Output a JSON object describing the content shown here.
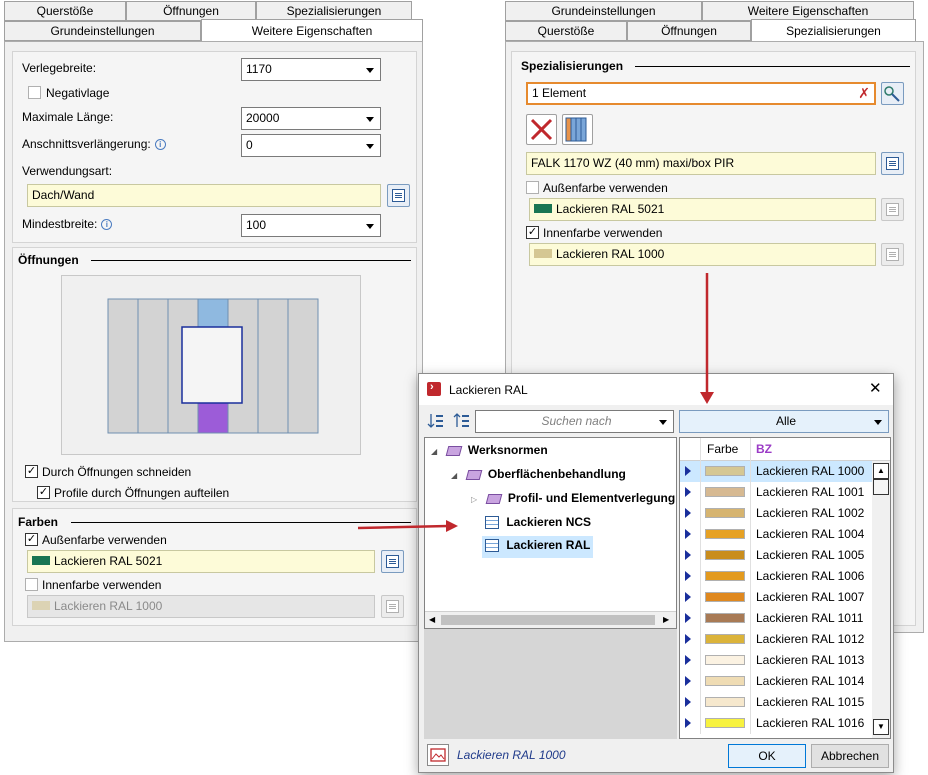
{
  "left": {
    "tabs_row1": [
      "Querstöße",
      "Öffnungen",
      "Spezialisierungen"
    ],
    "tabs_row2": [
      "Grundeinstellungen",
      "Weitere Eigenschaften"
    ],
    "verlegebreite_label": "Verlegebreite:",
    "verlegebreite_value": "1170",
    "negativlage_label": "Negativlage",
    "max_laenge_label": "Maximale Länge:",
    "max_laenge_value": "20000",
    "anschnitt_label": "Anschnittsverlängerung:",
    "anschnitt_value": "0",
    "verwendungsart_label": "Verwendungsart:",
    "verwendungsart_value": "Dach/Wand",
    "mindestbreite_label": "Mindestbreite:",
    "mindestbreite_value": "100",
    "info_glyph": "i",
    "oeffnungen_title": "Öffnungen",
    "durch_oeffnungen_label": "Durch Öffnungen schneiden",
    "profile_aufteilen_label": "Profile durch Öffnungen aufteilen",
    "farben_title": "Farben",
    "aussenfarbe_label": "Außenfarbe verwenden",
    "aussenfarbe_value": "Lackieren RAL 5021",
    "innenfarbe_label": "Innenfarbe verwenden",
    "innenfarbe_value": "Lackieren RAL 1000",
    "check_glyph": "✓"
  },
  "right": {
    "tabs_row1": [
      "Grundeinstellungen",
      "Weitere Eigenschaften"
    ],
    "tabs_row2": [
      "Querstöße",
      "Öffnungen",
      "Spezialisierungen"
    ],
    "group_title": "Spezialisierungen",
    "element_value": "1 Element",
    "product_value": "FALK 1170 WZ (40 mm) maxi/box PIR",
    "aussenfarbe_label": "Außenfarbe verwenden",
    "aussenfarbe_value": "Lackieren RAL 5021",
    "innenfarbe_label": "Innenfarbe verwenden",
    "innenfarbe_value": "Lackieren RAL 1000",
    "check_glyph": "✓"
  },
  "dialog": {
    "title": "Lackieren RAL",
    "close_glyph": "✕",
    "search_placeholder": "Suchen nach",
    "filter_value": "Alle",
    "tree": [
      {
        "label": "Werksnormen",
        "expander": "◢"
      },
      {
        "label": "Oberflächenbehandlung",
        "expander": "◢"
      },
      {
        "label": "Profil- und Elementverlegung",
        "expander": "▷"
      },
      {
        "label": "Lackieren NCS",
        "expander": ""
      },
      {
        "label": "Lackieren RAL",
        "expander": ""
      }
    ],
    "col_farbe": "Farbe",
    "col_bz": "BZ",
    "rows": [
      {
        "name": "Lackieren RAL 1000",
        "color": "#d5c793"
      },
      {
        "name": "Lackieren RAL 1001",
        "color": "#d6b992"
      },
      {
        "name": "Lackieren RAL 1002",
        "color": "#d6b470"
      },
      {
        "name": "Lackieren RAL 1004",
        "color": "#e6a124"
      },
      {
        "name": "Lackieren RAL 1005",
        "color": "#c98d1d"
      },
      {
        "name": "Lackieren RAL 1006",
        "color": "#e39a1e"
      },
      {
        "name": "Lackieren RAL 1007",
        "color": "#df881f"
      },
      {
        "name": "Lackieren RAL 1011",
        "color": "#a87a55"
      },
      {
        "name": "Lackieren RAL 1012",
        "color": "#dbb33a"
      },
      {
        "name": "Lackieren RAL 1013",
        "color": "#fbf2e2"
      },
      {
        "name": "Lackieren RAL 1014",
        "color": "#efdcb4"
      },
      {
        "name": "Lackieren RAL 1015",
        "color": "#f6e8cd"
      },
      {
        "name": "Lackieren RAL 1016",
        "color": "#f7f23f"
      }
    ],
    "status_text": "Lackieren RAL 1000",
    "ok_label": "OK",
    "cancel_label": "Abbrechen"
  },
  "colors": {
    "ral5021": "#197552",
    "ral1000": "#d5c793",
    "accent_red": "#c0282d",
    "selection": "#cce8ff",
    "field_yellow": "#fdfbd8"
  }
}
